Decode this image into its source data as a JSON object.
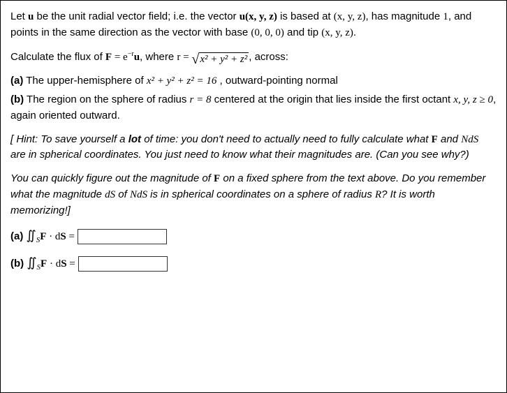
{
  "intro": {
    "p1_a": "Let ",
    "p1_b": " be the unit radial vector field; i.e. the vector ",
    "p1_c": " is based at ",
    "p1_d": ", has magnitude ",
    "p1_e": ", and points in the same direction as the vector with base ",
    "p1_f": " and tip ",
    "p1_g": "."
  },
  "calc": {
    "a": "Calculate the flux of ",
    "b": ", where ",
    "c": ", across:"
  },
  "parts": {
    "a1": "(a)",
    "a2": " The upper-hemisphere of ",
    "a3": " , outward-pointing normal",
    "b1": "(b)",
    "b2": " The region on the sphere of radius ",
    "b3": " centered at the origin that lies inside the first octant ",
    "b4": ", again oriented outward."
  },
  "hint": {
    "h1": "[ Hint: To save yourself a ",
    "h1b": "lot",
    "h1c": " of time: you don't need to actually need to fully calculate what ",
    "h2": " and ",
    "h3": " are in spherical coordinates. You just need to know what their magnitudes are. (Can you see why?)",
    "h4a": "You can quickly figure out the magnitude of ",
    "h4b": " on a fixed sphere from the text above. Do you remember what the magnitude ",
    "h4c": " of ",
    "h4d": " is in spherical coordinates on a sphere of radius ",
    "h4e": "? It is worth memorizing!]"
  },
  "answers": {
    "a_label": "(a) ",
    "b_label": "(b) ",
    "a_value": "",
    "b_value": ""
  },
  "mathtext": {
    "u_bold": "u",
    "u_xyz": "u(x, y, z)",
    "xyz": "(x, y, z)",
    "one": "1",
    "origin": "(0, 0, 0)",
    "F": "F",
    "F_eq": " = e",
    "neg_r": "−r",
    "r_eq": "r = ",
    "rad_expr": "x² + y² + z²",
    "sphere_eq": "x² + y² + z² = 16",
    "r8": "r = 8",
    "octant": "x, y, z ≥ 0",
    "NdS": "NdS",
    "dS": "dS",
    "R": "R",
    "flux_expr_a": "∬",
    "flux_sub": "S",
    "flux_mid": " · d",
    "flux_S": "S",
    "eq": " ="
  }
}
